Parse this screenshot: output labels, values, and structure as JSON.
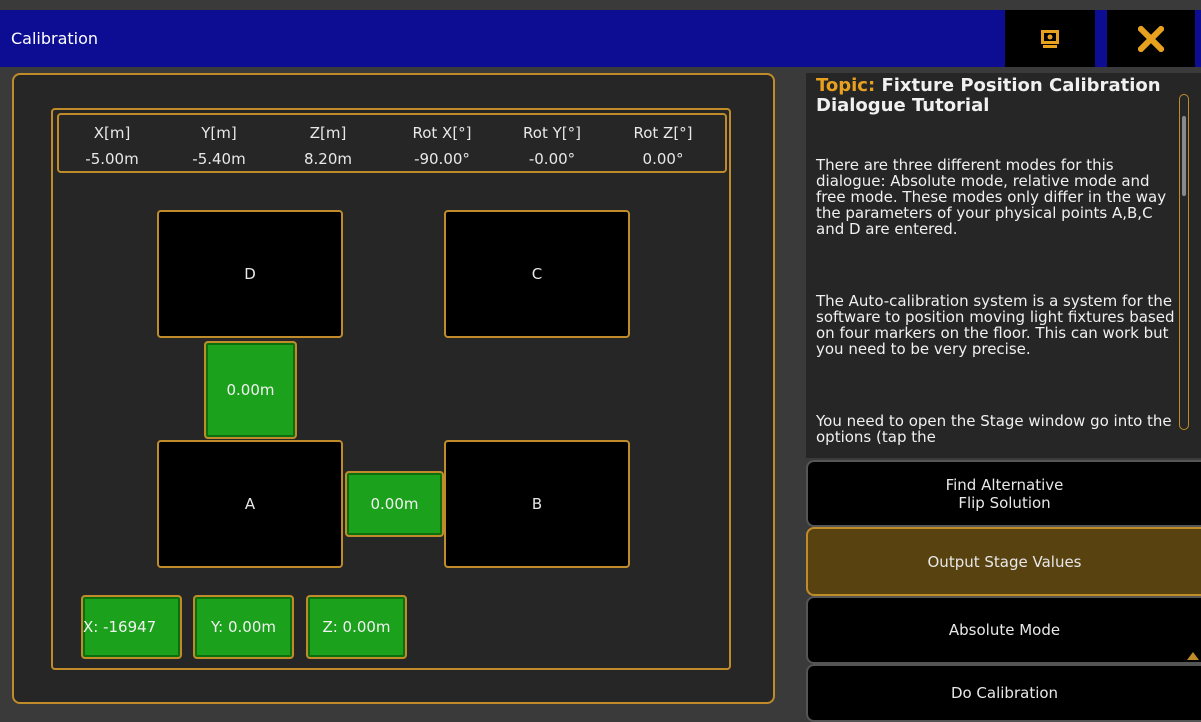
{
  "window": {
    "title": "Calibration",
    "icons": {
      "monitor": "monitor-icon",
      "close": "close-icon"
    },
    "colors": {
      "titlebar": "#0d0d94",
      "accent": "#e8a01f",
      "green": "#1ca11c"
    }
  },
  "coords": [
    {
      "label": "X[m]",
      "value": "-5.00m"
    },
    {
      "label": "Y[m]",
      "value": "-5.40m"
    },
    {
      "label": "Z[m]",
      "value": "8.20m"
    },
    {
      "label": "Rot X[°]",
      "value": "-90.00°"
    },
    {
      "label": "Rot Y[°]",
      "value": "-0.00°"
    },
    {
      "label": "Rot Z[°]",
      "value": "0.00°"
    }
  ],
  "points": {
    "d": "D",
    "c": "C",
    "a": "A",
    "b": "B"
  },
  "distances": {
    "d_to_a": "0.00m",
    "a_to_b": "0.00m"
  },
  "position_fields": {
    "x": "X: -16947",
    "y": "Y: 0.00m",
    "z": "Z: 0.00m"
  },
  "help": {
    "topic_label": "Topic:",
    "topic_title": "Fixture Position Calibration Dialogue Tutorial",
    "paragraphs": [
      "There are three different modes for this dialogue: Absolute mode, relative mode and free mode. These modes only differ in the way the parameters of your physical points A,B,C and D are entered.",
      "The Auto-calibration system is a system for the software to position moving light fixtures based on four markers on the floor. This can work but you need to be very precise.",
      "You need to open the Stage window go into the options (tap the"
    ]
  },
  "buttons": {
    "find_alt_line1": "Find Alternative",
    "find_alt_line2": "Flip Solution",
    "output_stage": "Output Stage Values",
    "absolute_mode": "Absolute Mode",
    "do_calibration": "Do Calibration"
  }
}
